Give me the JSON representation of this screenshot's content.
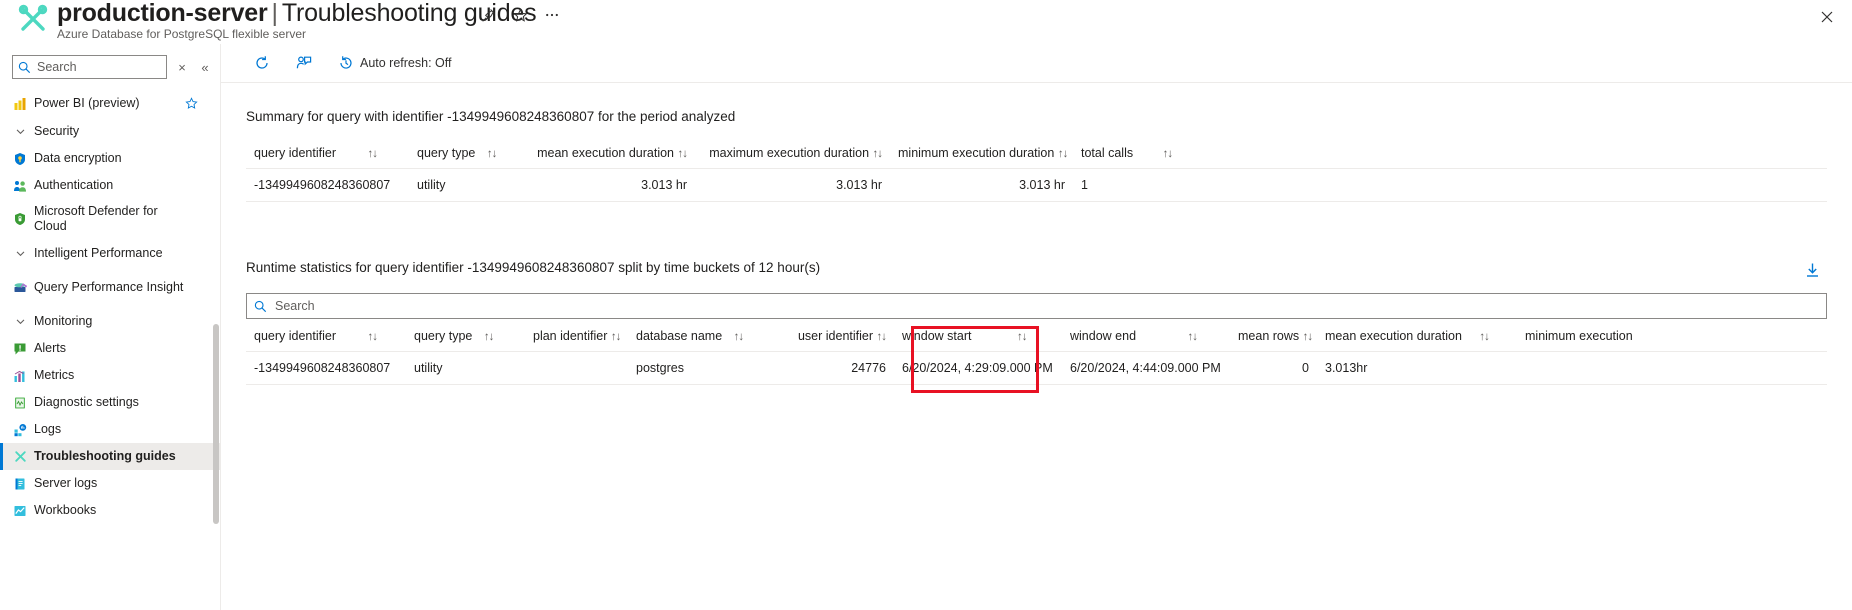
{
  "header": {
    "resource_name": "production-server",
    "separator": "|",
    "page_name": "Troubleshooting guides",
    "subtitle": "Azure Database for PostgreSQL flexible server",
    "pin_icon": "pin-icon",
    "favorite_icon": "star-icon",
    "more_icon": "ellipsis-icon",
    "close_icon": "close-icon"
  },
  "leftnav": {
    "search": {
      "placeholder": "Search",
      "value": ""
    },
    "clear_label": "×",
    "collapse_label": "«",
    "items": [
      {
        "label": "Power BI (preview)",
        "icon": "power-bi-icon",
        "type": "item",
        "favorite": true
      },
      {
        "label": "Security",
        "icon": "chevron-down-icon",
        "type": "group"
      },
      {
        "label": "Data encryption",
        "icon": "key-shield-icon",
        "type": "item"
      },
      {
        "label": "Authentication",
        "icon": "authentication-icon",
        "type": "item"
      },
      {
        "label": "Microsoft Defender for Cloud",
        "icon": "defender-shield-icon",
        "type": "item"
      },
      {
        "label": "Intelligent Performance",
        "icon": "chevron-down-icon",
        "type": "group"
      },
      {
        "label": "Query Performance Insight",
        "icon": "query-insight-icon",
        "type": "item"
      },
      {
        "label": "Monitoring",
        "icon": "chevron-down-icon",
        "type": "group"
      },
      {
        "label": "Alerts",
        "icon": "alerts-icon",
        "type": "item"
      },
      {
        "label": "Metrics",
        "icon": "metrics-icon",
        "type": "item"
      },
      {
        "label": "Diagnostic settings",
        "icon": "diagnostic-settings-icon",
        "type": "item"
      },
      {
        "label": "Logs",
        "icon": "logs-icon",
        "type": "item"
      },
      {
        "label": "Troubleshooting guides",
        "icon": "troubleshooting-icon",
        "type": "item",
        "selected": true
      },
      {
        "label": "Server logs",
        "icon": "server-logs-icon",
        "type": "item"
      },
      {
        "label": "Workbooks",
        "icon": "workbooks-icon",
        "type": "item"
      }
    ]
  },
  "commandbar": {
    "refresh_label": "",
    "refresh_icon": "refresh-icon",
    "feedback_icon": "feedback-icon",
    "autorefresh_icon": "clock-history-icon",
    "autorefresh_label": "Auto refresh: Off"
  },
  "summary": {
    "title": "Summary for query with identifier -1349949608248360807 for the period analyzed",
    "columns": [
      {
        "label": "query identifier",
        "sort": "↑↓",
        "align": "left"
      },
      {
        "label": "query type",
        "sort": "↑↓",
        "align": "left"
      },
      {
        "label": "mean execution duration",
        "sort": "↑↓",
        "align": "right"
      },
      {
        "label": "maximum execution duration",
        "sort": "↑↓",
        "align": "right"
      },
      {
        "label": "minimum execution duration",
        "sort": "↑↓",
        "align": "right"
      },
      {
        "label": "total calls",
        "sort": "↑↓",
        "align": "left"
      }
    ],
    "rows": [
      {
        "query_identifier": "-1349949608248360807",
        "query_type": "utility",
        "mean_execution_duration": "3.013 hr",
        "maximum_execution_duration": "3.013 hr",
        "minimum_execution_duration": "3.013 hr",
        "total_calls": "1"
      }
    ]
  },
  "runtime": {
    "title": "Runtime statistics for query identifier -1349949608248360807 split by time buckets of 12 hour(s)",
    "download_icon": "download-icon",
    "search": {
      "placeholder": "Search",
      "value": ""
    },
    "columns": [
      {
        "label": "query identifier",
        "sort": "↑↓"
      },
      {
        "label": "query type",
        "sort": "↑↓"
      },
      {
        "label": "plan identifier",
        "sort": "↑↓"
      },
      {
        "label": "database name",
        "sort": "↑↓"
      },
      {
        "label": "user identifier",
        "sort": "↑↓"
      },
      {
        "label": "window start",
        "sort": "↑↓"
      },
      {
        "label": "window end",
        "sort": "↑↓"
      },
      {
        "label": "mean rows",
        "sort": "↑↓"
      },
      {
        "label": "mean execution duration",
        "sort": "↑↓"
      },
      {
        "label": "minimum execution",
        "sort": ""
      }
    ],
    "rows": [
      {
        "query_identifier": "-1349949608248360807",
        "query_type": "utility",
        "plan_identifier": "",
        "database_name": "postgres",
        "user_identifier": "24776",
        "window_start": "6/20/2024, 4:29:09.000 PM",
        "window_end": "6/20/2024, 4:44:09.000 PM",
        "mean_rows": "0",
        "mean_execution_duration": "3.013hr",
        "minimum_execution": ""
      }
    ],
    "highlight": {
      "color": "#e81123",
      "target_column": "user identifier"
    }
  }
}
